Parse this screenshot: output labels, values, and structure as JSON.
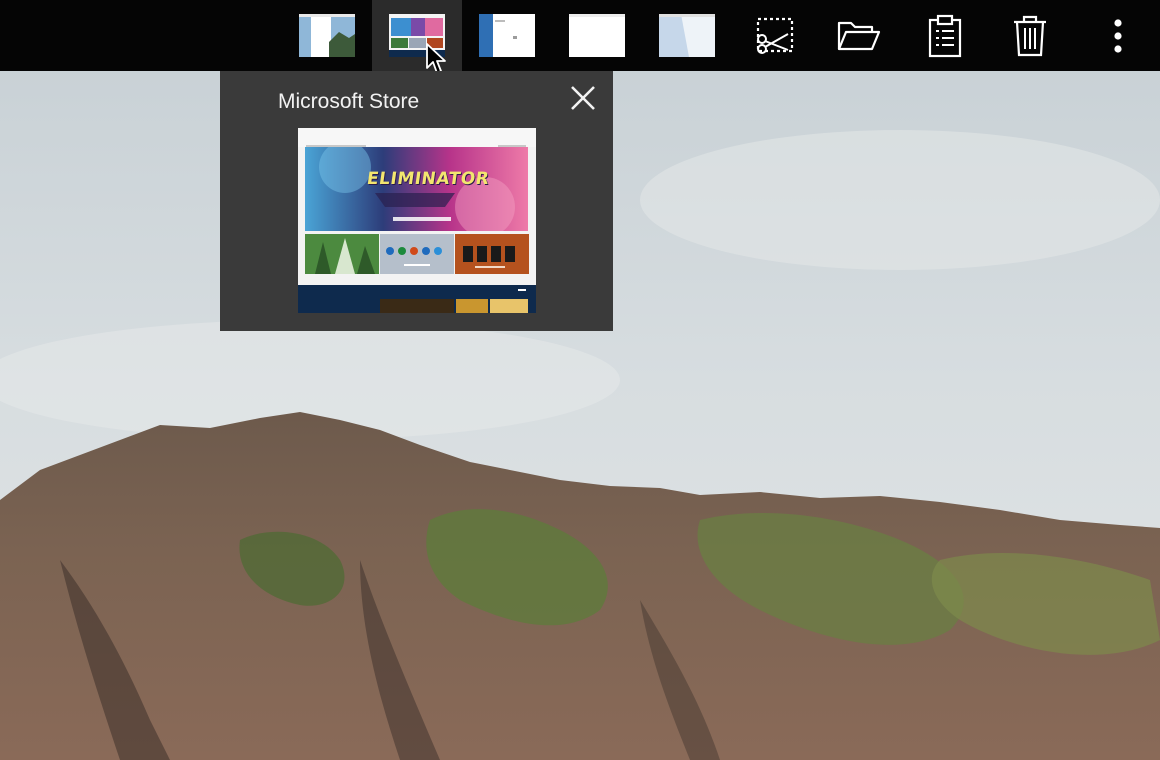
{
  "toolbar": {
    "tools": [
      {
        "name": "snip-icon"
      },
      {
        "name": "open-folder-icon"
      },
      {
        "name": "clipboard-icon"
      },
      {
        "name": "trash-icon"
      },
      {
        "name": "more-options-icon"
      }
    ]
  },
  "preview_popup": {
    "title": "Microsoft Store",
    "hero_logo_text": "ELIMINATOR"
  },
  "colors": {
    "toolbar_bg": "#050505",
    "active_thumb_bg": "#2b2b2b",
    "popup_bg": "#3a3a3a",
    "icon_color": "#ffffff"
  }
}
